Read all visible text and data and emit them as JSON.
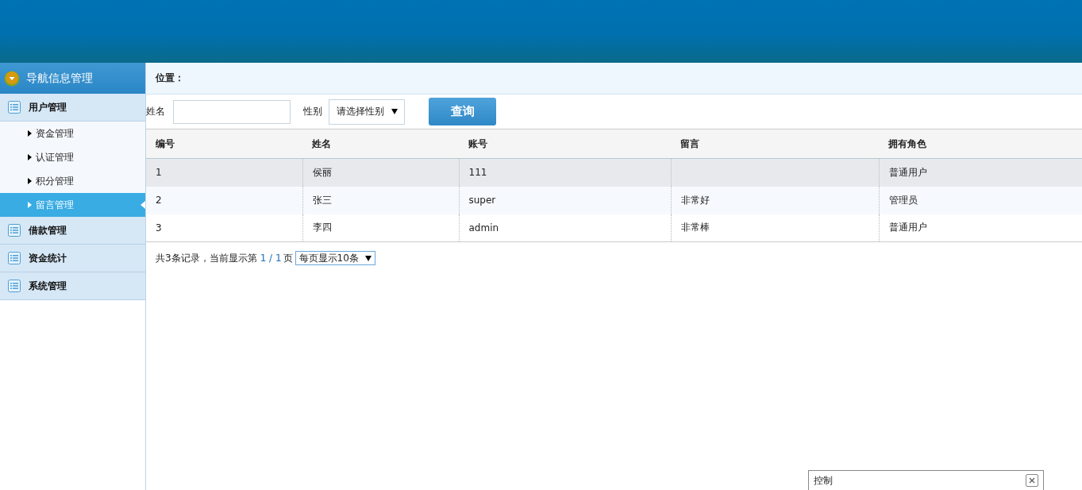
{
  "sidebar": {
    "title": "导航信息管理",
    "groups": [
      {
        "label": "用户管理",
        "children": [
          {
            "label": "资金管理",
            "selected": false
          },
          {
            "label": "认证管理",
            "selected": false
          },
          {
            "label": "积分管理",
            "selected": false
          },
          {
            "label": "留言管理",
            "selected": true
          }
        ]
      },
      {
        "label": "借款管理"
      },
      {
        "label": "资金统计"
      },
      {
        "label": "系统管理"
      }
    ]
  },
  "breadcrumb": {
    "label": "位置："
  },
  "filters": {
    "name_label": "姓名",
    "gender_label": "性别",
    "gender_value": "请选择性别",
    "button": "查询"
  },
  "table": {
    "columns": [
      "编号",
      "姓名",
      "账号",
      "留言",
      "拥有角色"
    ],
    "rows": [
      {
        "cells": [
          "1",
          "侯丽",
          "111",
          "",
          "普通用户"
        ],
        "highlighted": true
      },
      {
        "cells": [
          "2",
          "张三",
          "super",
          "非常好",
          "管理员"
        ],
        "highlighted": false
      },
      {
        "cells": [
          "3",
          "李四",
          "admin",
          "非常棒",
          "普通用户"
        ],
        "highlighted": false
      }
    ]
  },
  "pager": {
    "prefix": "共3条记录，当前显示第",
    "pages": "1 / 1",
    "suffix": "页",
    "page_size": "每页显示10条"
  },
  "control_panel": {
    "title": "控制"
  }
}
